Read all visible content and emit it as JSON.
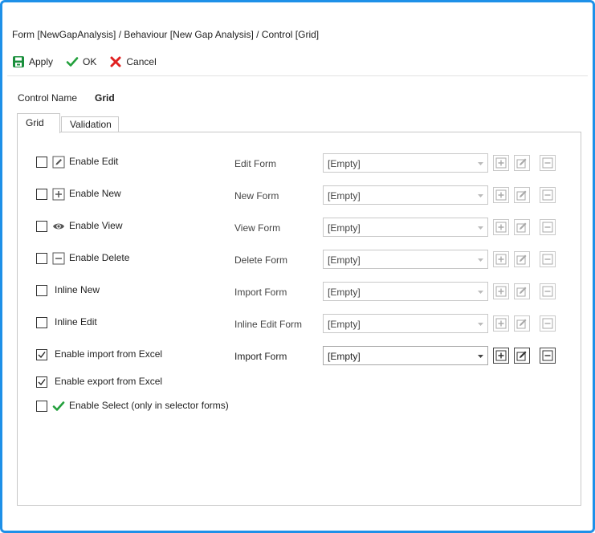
{
  "window": {
    "title": "Form [NewGapAnalysis] / Behaviour [New Gap Analysis] / Control [Grid]"
  },
  "toolbar": {
    "apply_label": "Apply",
    "ok_label": "OK",
    "cancel_label": "Cancel"
  },
  "control": {
    "name_label": "Control Name",
    "name_value": "Grid"
  },
  "tabs": [
    {
      "label": "Grid",
      "active": true
    },
    {
      "label": "Validation",
      "active": false
    }
  ],
  "options": [
    {
      "label": "Enable Edit",
      "checked": false,
      "icon": "pencil-icon",
      "form_label": "Edit Form",
      "form_value": "[Empty]",
      "enabled": false
    },
    {
      "label": "Enable New",
      "checked": false,
      "icon": "plus-box-icon",
      "form_label": "New Form",
      "form_value": "[Empty]",
      "enabled": false
    },
    {
      "label": "Enable View",
      "checked": false,
      "icon": "eye-icon",
      "form_label": "View Form",
      "form_value": "[Empty]",
      "enabled": false
    },
    {
      "label": "Enable Delete",
      "checked": false,
      "icon": "minus-box-icon",
      "form_label": "Delete Form",
      "form_value": "[Empty]",
      "enabled": false
    },
    {
      "label": "Inline New",
      "checked": false,
      "icon": "",
      "form_label": "Import Form",
      "form_value": "[Empty]",
      "enabled": false
    },
    {
      "label": "Inline Edit",
      "checked": false,
      "icon": "",
      "form_label": "Inline Edit Form",
      "form_value": "[Empty]",
      "enabled": false
    },
    {
      "label": "Enable import from Excel",
      "checked": true,
      "icon": "",
      "form_label": "Import Form",
      "form_value": "[Empty]",
      "enabled": true
    },
    {
      "label": "Enable export from Excel",
      "checked": true,
      "icon": ""
    },
    {
      "label": "Enable Select (only in selector forms)",
      "checked": false,
      "icon": "check-icon"
    }
  ],
  "colors": {
    "accent_border": "#1e90e8",
    "apply_green": "#1a8f3c",
    "ok_green": "#23a03c",
    "cancel_red": "#e02020"
  }
}
